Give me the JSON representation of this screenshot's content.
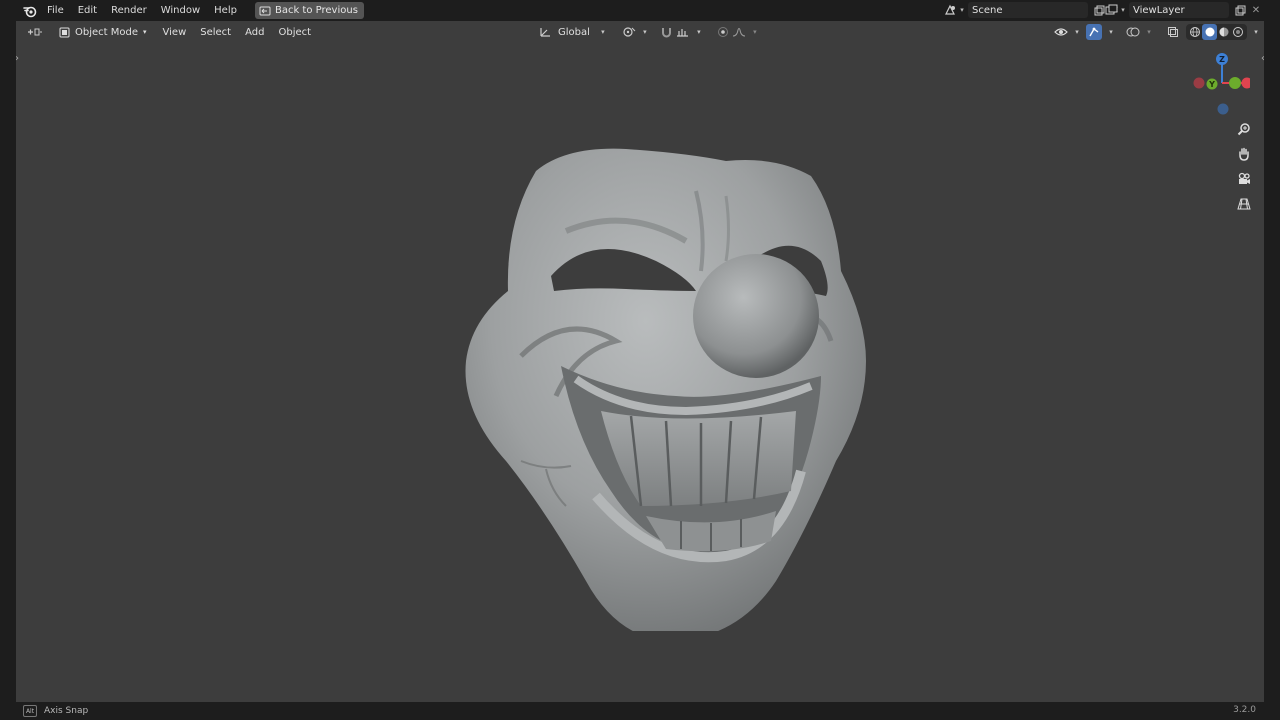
{
  "topbar": {
    "menus": [
      "File",
      "Edit",
      "Render",
      "Window",
      "Help"
    ],
    "back_button": "Back to Previous",
    "scene": "Scene",
    "view_layer": "ViewLayer"
  },
  "viewport_header": {
    "mode": "Object Mode",
    "menus": [
      "View",
      "Select",
      "Add",
      "Object"
    ],
    "transform_orientation": "Global"
  },
  "gizmo": {
    "z_label": "Z",
    "y_label": "Y"
  },
  "statusbar": {
    "key": "Alt",
    "hint": "Axis Snap",
    "version": "3.2.0"
  },
  "colors": {
    "viewport_bg": "#3d3d3d",
    "bar_bg": "#1d1d1d",
    "accent": "#4772b3",
    "axis_x": "#e0444f",
    "axis_y": "#6cac2c",
    "axis_z": "#3d80d6"
  }
}
